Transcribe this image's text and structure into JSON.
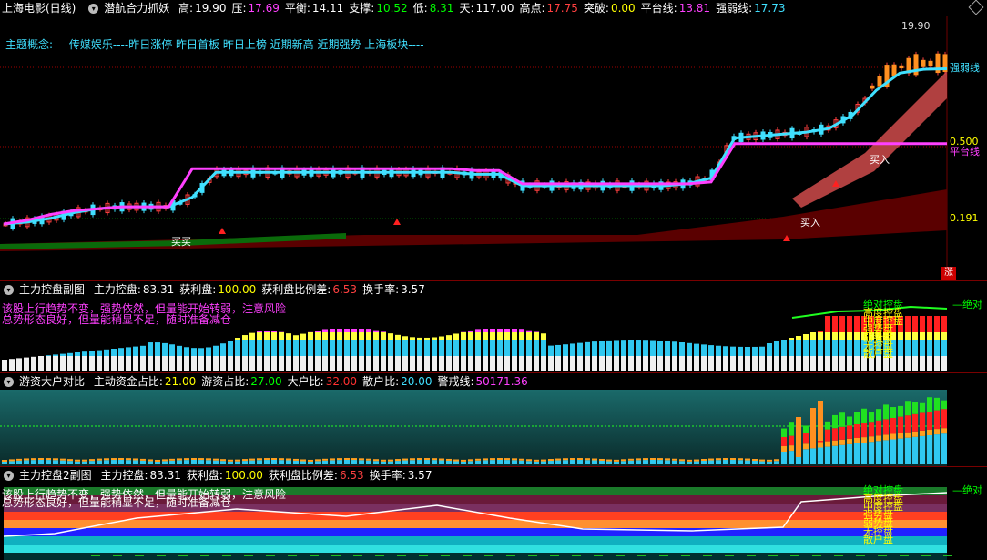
{
  "main_pane": {
    "stock_name": "上海电影(日线)",
    "indicator": "潜航合力抓妖",
    "fields": [
      {
        "label": "高:",
        "value": "19.90",
        "color": "#ffffff"
      },
      {
        "label": "压:",
        "value": "17.69",
        "color": "#ff40ff"
      },
      {
        "label": "平衡:",
        "value": "14.11",
        "color": "#ffffff"
      },
      {
        "label": "支撑:",
        "value": "10.52",
        "color": "#00ff00"
      },
      {
        "label": "低:",
        "value": "8.31",
        "color": "#00ff00"
      },
      {
        "label": "天:",
        "value": "117.00",
        "color": "#ffffff"
      },
      {
        "label": "高点:",
        "value": "17.75",
        "color": "#ff4040"
      },
      {
        "label": "突破:",
        "value": "0.00",
        "color": "#ffff00"
      },
      {
        "label": "平台线:",
        "value": "13.81",
        "color": "#ff40ff"
      },
      {
        "label": "强弱线:",
        "value": "17.73",
        "color": "#40e0ff"
      }
    ],
    "concept_label": "主题概念:",
    "concept_text": "传媒娱乐----昨日涨停 昨日首板 昨日上榜 近期新高 近期强势 上海板块----",
    "price_high_label": "19.90",
    "scale_labels": [
      "0.500",
      "0.191"
    ],
    "right_labels": [
      "强弱线",
      "平台线"
    ],
    "buy_labels": [
      "买入",
      "买入",
      "买买"
    ],
    "zhang_badge": "涨",
    "chart_data": {
      "type": "line",
      "series": [
        {
          "name": "强弱线",
          "values": [
            9.6,
            9.7,
            9.9,
            10.2,
            10.4,
            10.5,
            10.5,
            10.5,
            11.0,
            12.3,
            12.3,
            12.3,
            12.3,
            12.3,
            12.3,
            12.3,
            12.3,
            12.3,
            12.3,
            12.3,
            12.2,
            12.2,
            11.6,
            11.6,
            11.6,
            11.6,
            11.6,
            11.6,
            11.6,
            11.7,
            12.0,
            14.1,
            14.2,
            14.3,
            14.4,
            14.6,
            15.3,
            16.6,
            17.5,
            17.7,
            17.73
          ]
        },
        {
          "name": "平台线",
          "values": [
            9.6,
            9.8,
            10.1,
            10.3,
            10.4,
            10.5,
            10.5,
            10.5,
            12.5,
            12.5,
            12.5,
            12.5,
            12.5,
            12.5,
            12.5,
            12.5,
            12.5,
            12.5,
            12.5,
            12.5,
            12.4,
            12.4,
            11.7,
            11.7,
            11.7,
            11.7,
            11.7,
            11.7,
            11.7,
            11.7,
            11.8,
            13.81,
            13.81,
            13.81,
            13.81,
            13.81,
            13.81,
            13.81,
            13.81,
            13.81,
            13.81
          ]
        }
      ],
      "ylim": [
        8.31,
        19.9
      ]
    }
  },
  "pane2": {
    "title": "主力控盘副图",
    "fields": [
      {
        "label": "主力控盘:",
        "value": "83.31",
        "color": "#ffffff"
      },
      {
        "label": "获利盘:",
        "value": "100.00",
        "color": "#ffff00"
      },
      {
        "label": "获利盘比例差:",
        "value": "6.53",
        "color": "#ff4040"
      },
      {
        "label": "换手率:",
        "value": "3.57",
        "color": "#ffffff"
      }
    ],
    "comment1": "该股上行趋势不变，强势依然，但量能开始转弱，注意风险",
    "comment2": "总势形态良好，但量能稍显不足，随时准备减仓",
    "legend": [
      "绝对控盘",
      "高度控盘",
      "中度控盘",
      "强势盘",
      "弱势盘",
      "无控盘",
      "散户盘"
    ],
    "right_label": "绝对"
  },
  "pane3": {
    "title": "游资大户对比",
    "fields": [
      {
        "label": "主动资金占比:",
        "value": "21.00",
        "color": "#ffff00"
      },
      {
        "label": "游资占比:",
        "value": "27.00",
        "color": "#00ff00"
      },
      {
        "label": "大户比:",
        "value": "32.00",
        "color": "#ff3030"
      },
      {
        "label": "散户比:",
        "value": "20.00",
        "color": "#40e0ff"
      },
      {
        "label": "警戒线:",
        "value": "50171.36",
        "color": "#ff40ff"
      }
    ]
  },
  "pane4": {
    "title": "主力控盘2副图",
    "fields": [
      {
        "label": "主力控盘:",
        "value": "83.31",
        "color": "#ffffff"
      },
      {
        "label": "获利盘:",
        "value": "100.00",
        "color": "#ffff00"
      },
      {
        "label": "获利盘比例差:",
        "value": "6.53",
        "color": "#ff4040"
      },
      {
        "label": "换手率:",
        "value": "3.57",
        "color": "#ffffff"
      }
    ],
    "comment1": "该股上行趋势不变，强势依然，但量能开始转弱，注意风险",
    "comment2": "总势形态良好，但量能稍显不足，随时准备减仓",
    "legend": [
      "绝对控盘",
      "高度控盘",
      "中度控盘",
      "强势盘",
      "弱势盘",
      "无控盘",
      "散户盘"
    ],
    "right_label": "绝对"
  }
}
